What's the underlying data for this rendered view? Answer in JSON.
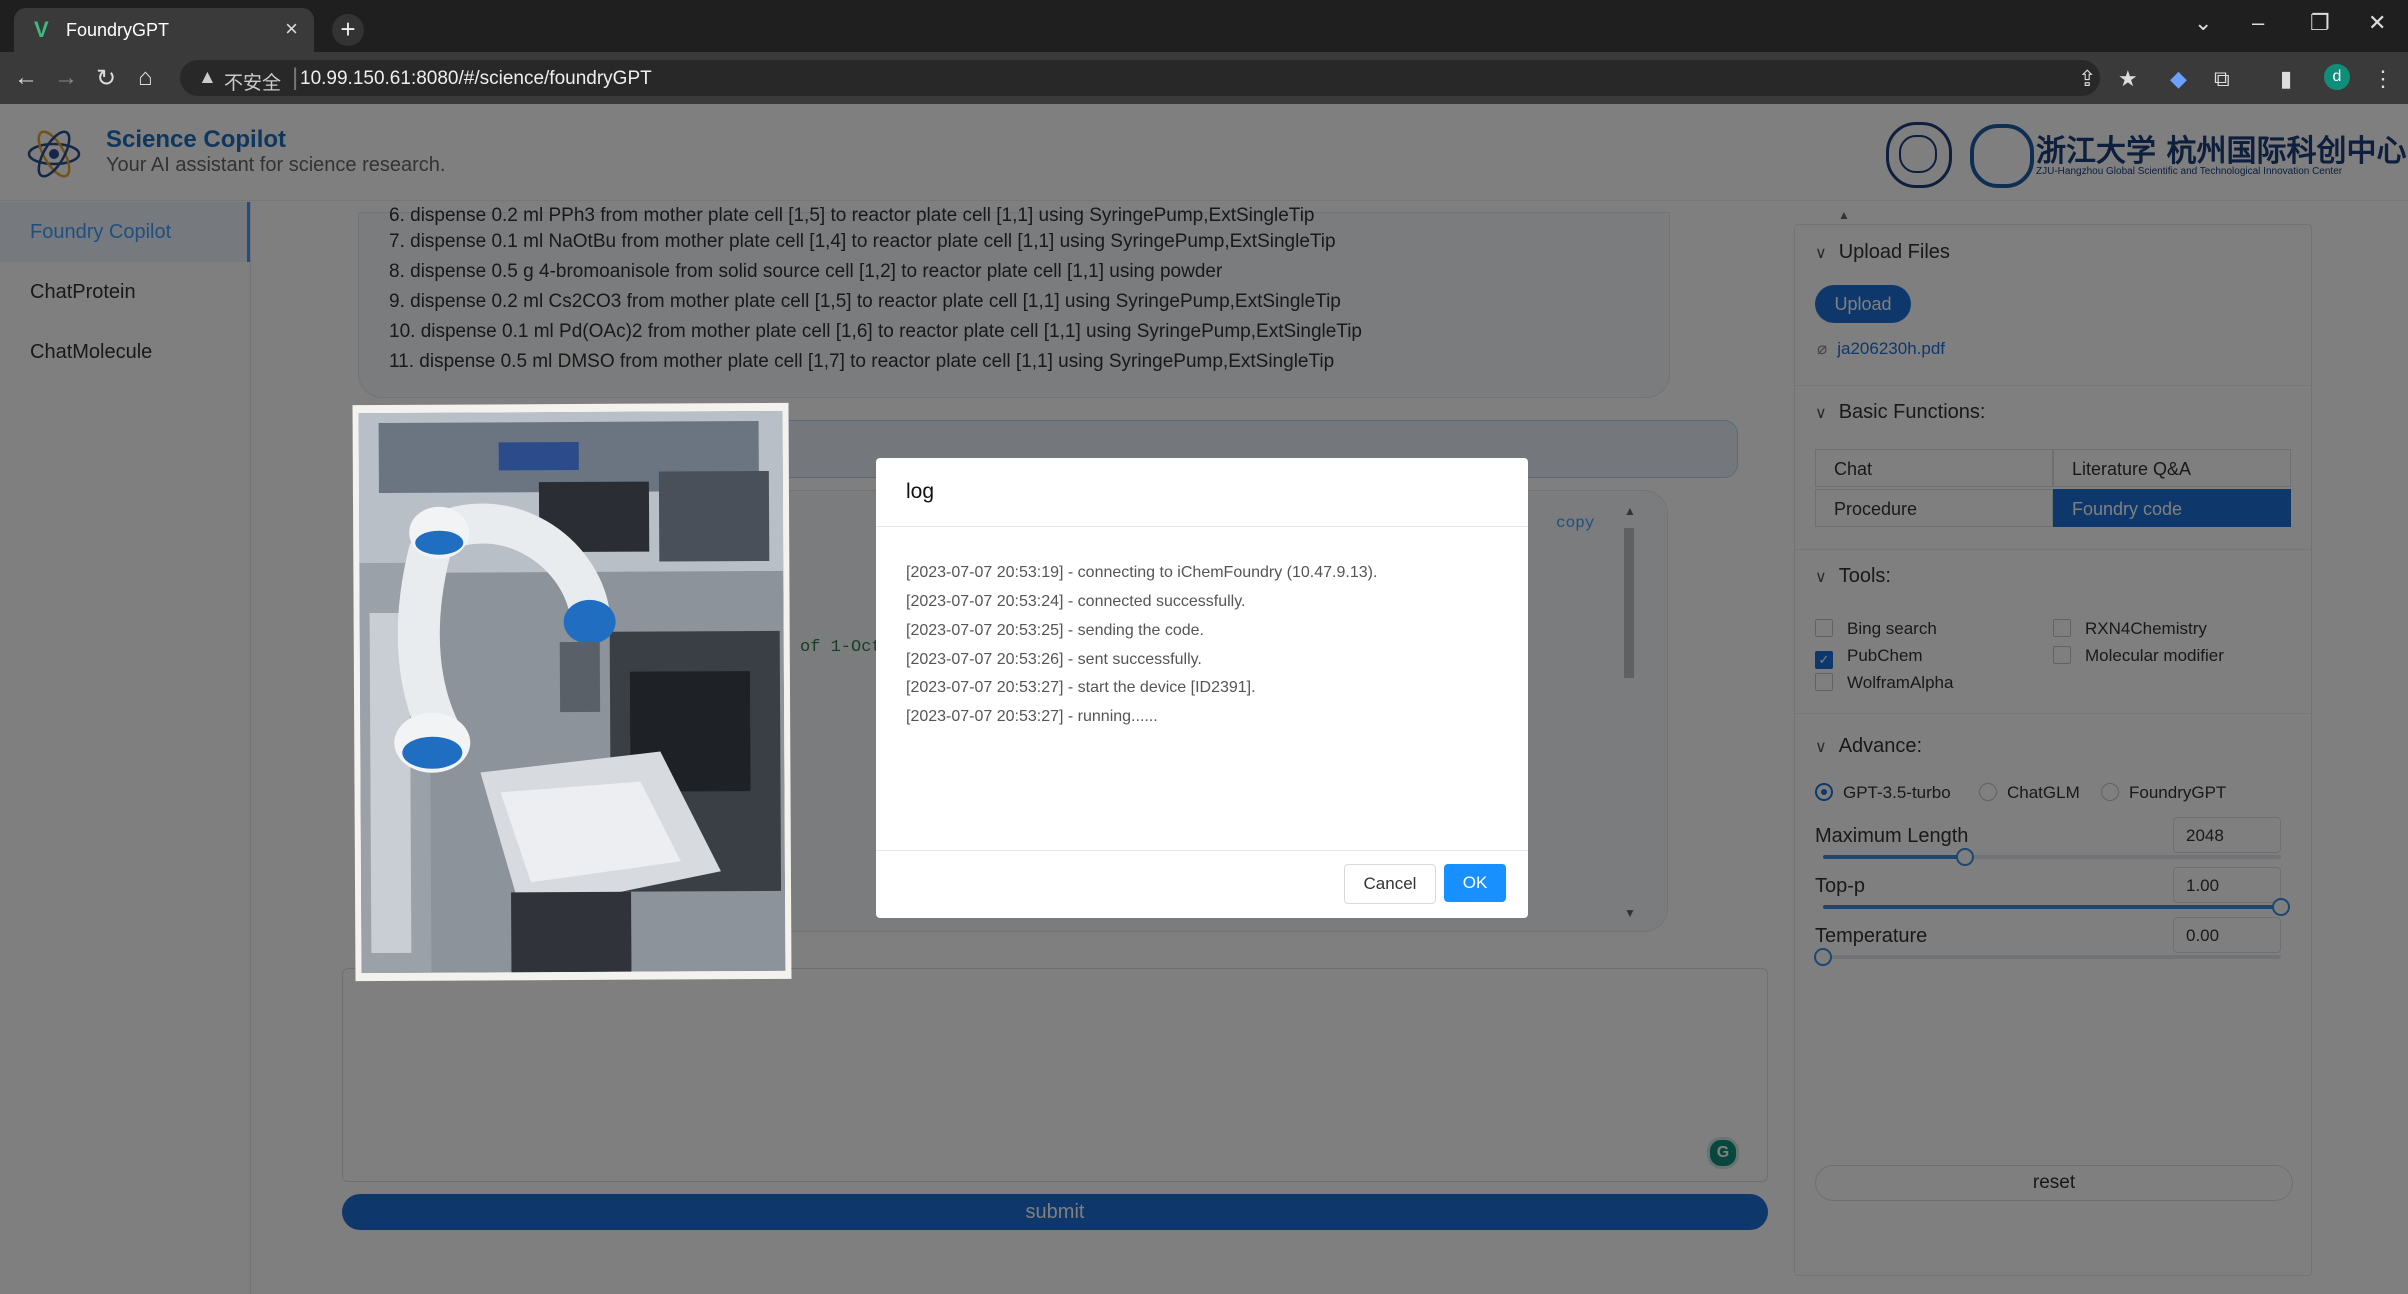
{
  "browser": {
    "tab_title": "FoundryGPT",
    "security_label": "不安全",
    "url": "10.99.150.61:8080/#/science/foundryGPT",
    "profile_initial": "d"
  },
  "header": {
    "title": "Science Copilot",
    "subtitle": "Your AI assistant for science research.",
    "logo_cn": "浙江大学 杭州国际科创中心",
    "logo_en": "ZJU-Hangzhou Global Scientific and Technological Innovation Center"
  },
  "sidebar": {
    "items": [
      {
        "label": "Foundry Copilot"
      },
      {
        "label": "ChatProtein"
      },
      {
        "label": "ChatMolecule"
      }
    ]
  },
  "chat": {
    "steps": [
      "6. dispense 0.2 ml PPh3 from mother plate cell [1,5] to reactor plate cell [1,1] using SyringePump,ExtSingleTip",
      "7. dispense 0.1 ml NaOtBu from mother plate cell [1,4] to reactor plate cell [1,1] using SyringePump,ExtSingleTip",
      "8. dispense 0.5 g 4-bromoanisole from solid source cell [1,2] to reactor plate cell [1,1] using powder",
      "9. dispense 0.2 ml Cs2CO3 from mother plate cell [1,5] to reactor plate cell [1,1] using SyringePump,ExtSingleTip",
      "10. dispense 0.1 ml Pd(OAc)2 from mother plate cell [1,6] to reactor plate cell [1,1] using SyringePump,ExtSingleTip",
      "11. dispense 0.5 ml DMSO from mother plate cell [1,7] to reactor plate cell [1,1] using SyringePump,ExtSingleTip"
    ],
    "copy_label": "copy",
    "code_fragment": "of 1-Oct"
  },
  "submit_label": "submit",
  "panel": {
    "upload": {
      "title": "Upload Files",
      "button": "Upload",
      "file": "ja206230h.pdf"
    },
    "basic": {
      "title": "Basic Functions:",
      "options": [
        "Chat",
        "Literature Q&A",
        "Procedure",
        "Foundry code"
      ],
      "selected": "Foundry code"
    },
    "tools": {
      "title": "Tools:",
      "items": [
        {
          "label": "Bing search",
          "checked": false
        },
        {
          "label": "RXN4Chemistry",
          "checked": false
        },
        {
          "label": "PubChem",
          "checked": true
        },
        {
          "label": "Molecular modifier",
          "checked": false
        },
        {
          "label": "WolframAlpha",
          "checked": false
        }
      ]
    },
    "advance": {
      "title": "Advance:",
      "models": [
        "GPT-3.5-turbo",
        "ChatGLM",
        "FoundryGPT"
      ],
      "selected_model": "GPT-3.5-turbo",
      "max_length": {
        "label": "Maximum Length",
        "value": "2048",
        "fraction": 0.31
      },
      "top_p": {
        "label": "Top-p",
        "value": "1.00",
        "fraction": 1.0
      },
      "temperature": {
        "label": "Temperature",
        "value": "0.00",
        "fraction": 0.0
      },
      "reset_label": "reset"
    }
  },
  "dialog": {
    "title": "log",
    "lines": [
      "[2023-07-07 20:53:19] - connecting to iChemFoundry (10.47.9.13).",
      "[2023-07-07 20:53:24] - connected successfully.",
      "[2023-07-07 20:53:25] - sending the code.",
      "[2023-07-07 20:53:26] - sent successfully.",
      "[2023-07-07 20:53:27] - start the device [ID2391].",
      "[2023-07-07 20:53:27] - running......"
    ],
    "cancel_label": "Cancel",
    "ok_label": "OK"
  },
  "colors": {
    "accent": "#1d6fd9",
    "brand_title": "#1d6fbf",
    "ok_button": "#1890ff"
  }
}
